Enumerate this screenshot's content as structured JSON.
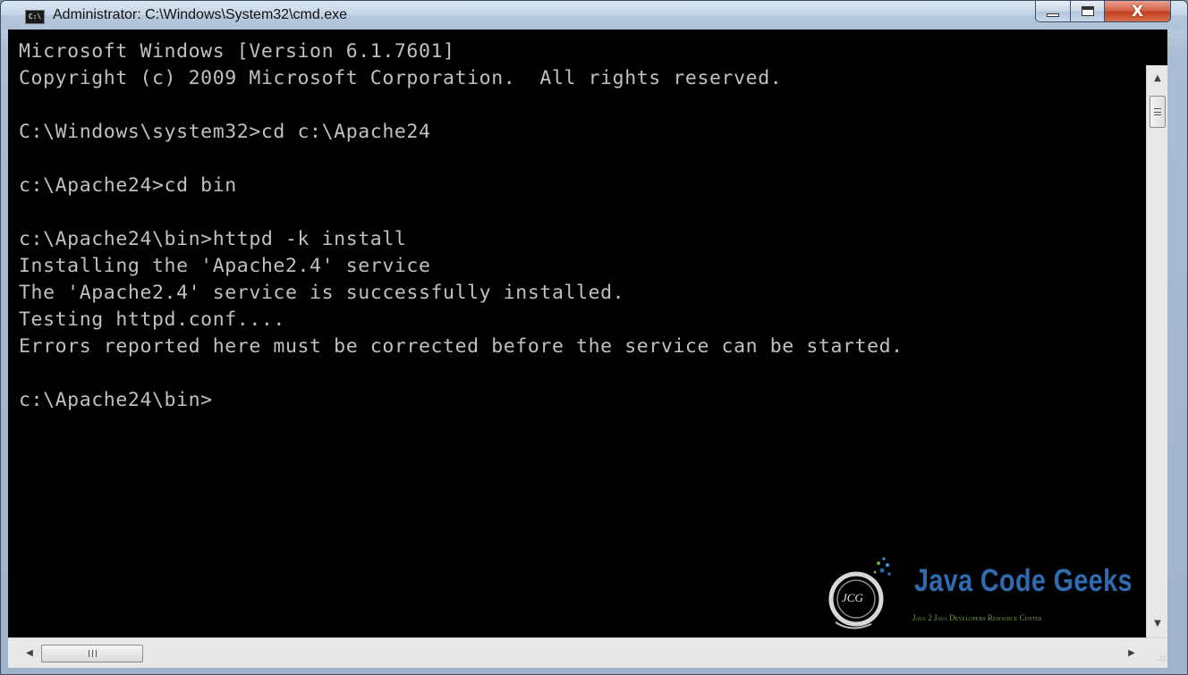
{
  "window": {
    "title": "Administrator: C:\\Windows\\System32\\cmd.exe",
    "app_icon_text": "C:\\",
    "controls": {
      "minimize": "minimize",
      "maximize": "maximize",
      "close": "X"
    }
  },
  "console": {
    "lines": [
      "Microsoft Windows [Version 6.1.7601]",
      "Copyright (c) 2009 Microsoft Corporation.  All rights reserved.",
      "",
      "C:\\Windows\\system32>cd c:\\Apache24",
      "",
      "c:\\Apache24>cd bin",
      "",
      "c:\\Apache24\\bin>httpd -k install",
      "Installing the 'Apache2.4' service",
      "The 'Apache2.4' service is successfully installed.",
      "Testing httpd.conf....",
      "Errors reported here must be corrected before the service can be started.",
      "",
      "c:\\Apache24\\bin>"
    ],
    "text_color": "#c0c0c0",
    "background_color": "#000000"
  },
  "scrollbars": {
    "up_arrow": "▲",
    "down_arrow": "▼",
    "left_arrow": "◀",
    "right_arrow": "▶",
    "resize_grip": ".::"
  },
  "watermark": {
    "monogram": "JCG",
    "title": "Java Code Geeks",
    "subtitle": "Java 2 Java Developers Resource Center",
    "title_color": "#2f6bb0",
    "subtitle_color": "#7a9a55"
  }
}
